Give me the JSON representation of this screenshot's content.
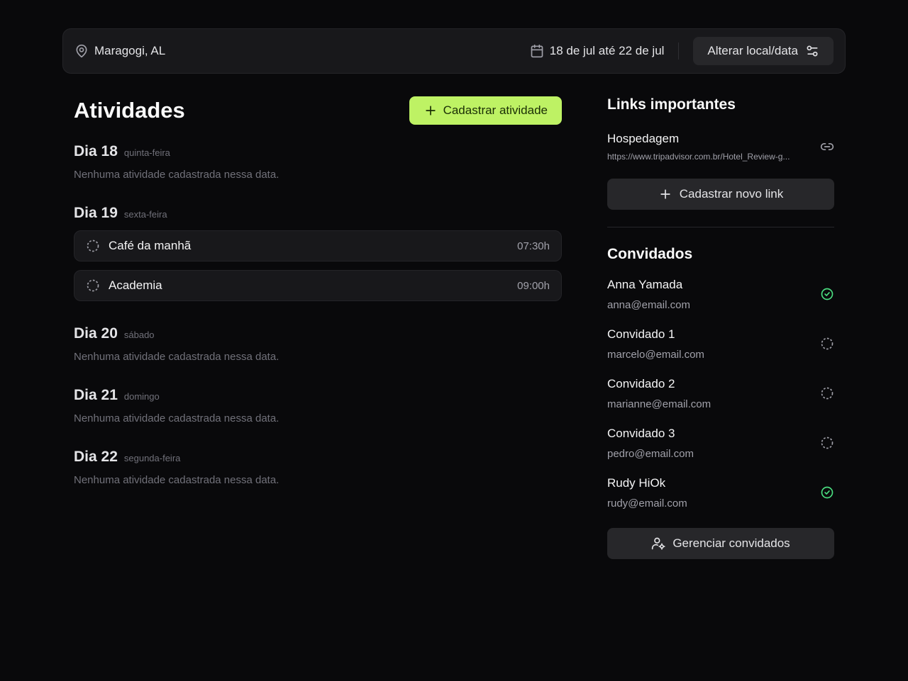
{
  "header": {
    "location": "Maragogi, AL",
    "dates": "18 de jul até 22 de jul",
    "change_label": "Alterar local/data"
  },
  "activities": {
    "title": "Atividades",
    "add_label": "Cadastrar atividade",
    "empty_text": "Nenhuma atividade cadastrada nessa data.",
    "days": [
      {
        "label": "Dia 18",
        "weekday": "quinta-feira"
      },
      {
        "label": "Dia 19",
        "weekday": "sexta-feira",
        "items": [
          {
            "name": "Café da manhã",
            "time": "07:30h"
          },
          {
            "name": "Academia",
            "time": "09:00h"
          }
        ]
      },
      {
        "label": "Dia 20",
        "weekday": "sábado"
      },
      {
        "label": "Dia 21",
        "weekday": "domingo"
      },
      {
        "label": "Dia 22",
        "weekday": "segunda-feira"
      }
    ]
  },
  "links": {
    "title": "Links importantes",
    "items": [
      {
        "title": "Hospedagem",
        "url": "https://www.tripadvisor.com.br/Hotel_Review-g..."
      }
    ],
    "add_label": "Cadastrar novo link"
  },
  "guests": {
    "title": "Convidados",
    "items": [
      {
        "name": "Anna Yamada",
        "email": "anna@email.com",
        "confirmed": true
      },
      {
        "name": "Convidado 1",
        "email": "marcelo@email.com",
        "confirmed": false
      },
      {
        "name": "Convidado 2",
        "email": "marianne@email.com",
        "confirmed": false
      },
      {
        "name": "Convidado 3",
        "email": "pedro@email.com",
        "confirmed": false
      },
      {
        "name": "Rudy HiOk",
        "email": "rudy@email.com",
        "confirmed": true
      }
    ],
    "manage_label": "Gerenciar convidados"
  },
  "colors": {
    "accent": "#bef264",
    "confirmed": "#4ade80",
    "background": "#09090b",
    "surface": "#18181b"
  }
}
